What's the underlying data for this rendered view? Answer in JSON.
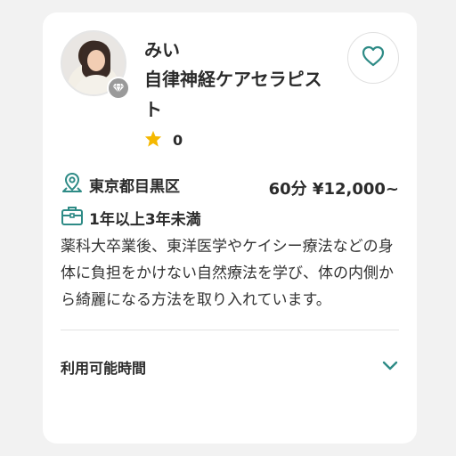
{
  "therapist": {
    "name": "みい",
    "title": "自律神経ケアセラピスト",
    "rating": "0",
    "location": "東京都目黒区",
    "price": "60分 ¥12,000~",
    "experience": "1年以上3年未満",
    "description": "薬科大卒業後、東洋医学やケイシー療法などの身体に負担をかけない自然療法を学び、体の内側から綺麗になる方法を取り入れています。"
  },
  "availability": {
    "label": "利用可能時間"
  },
  "colors": {
    "accent": "#2e8b86",
    "star": "#f5b800",
    "badge": "#9a9a9a"
  },
  "icons": {
    "favorite": "heart-outline-icon",
    "location": "map-pin-icon",
    "experience": "briefcase-icon",
    "expand": "chevron-down-icon",
    "verified": "diamond-icon",
    "rating": "star-icon"
  }
}
